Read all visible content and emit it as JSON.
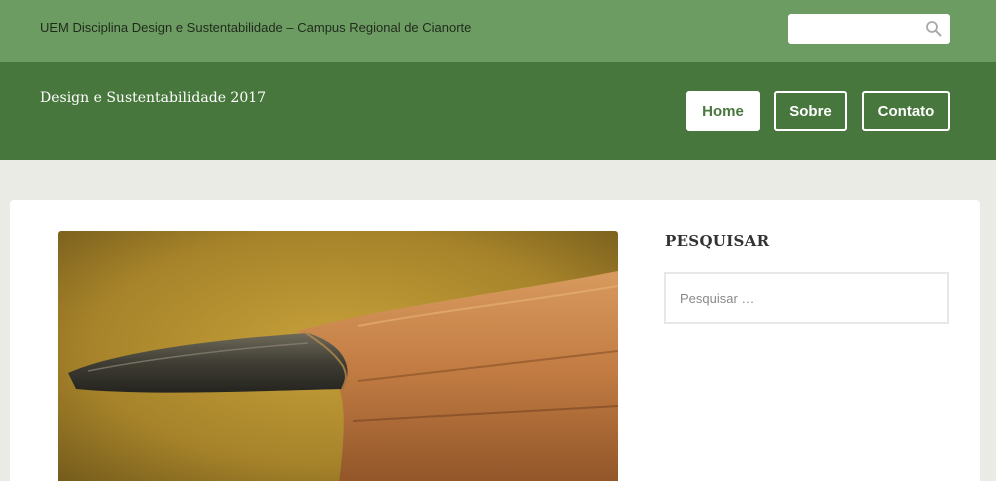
{
  "topbar": {
    "title": "UEM Disciplina Design e Sustentabilidade – Campus Regional de Cianorte",
    "search": {
      "value": "",
      "placeholder": "",
      "icon": "search-icon"
    }
  },
  "header": {
    "site_title": "Design e Sustentabilidade 2017",
    "nav": [
      {
        "label": "Home",
        "active": true
      },
      {
        "label": "Sobre",
        "active": false
      },
      {
        "label": "Contato",
        "active": false
      }
    ]
  },
  "main": {
    "featured_image": {
      "subject": "pencil-tip-photo"
    }
  },
  "sidebar": {
    "widget_title": "PESQUISAR",
    "search_placeholder": "Pesquisar …"
  },
  "colors": {
    "topbar": "#6d9c63",
    "header": "#47773c",
    "background": "#e9ebe4",
    "panel": "#ffffff"
  }
}
